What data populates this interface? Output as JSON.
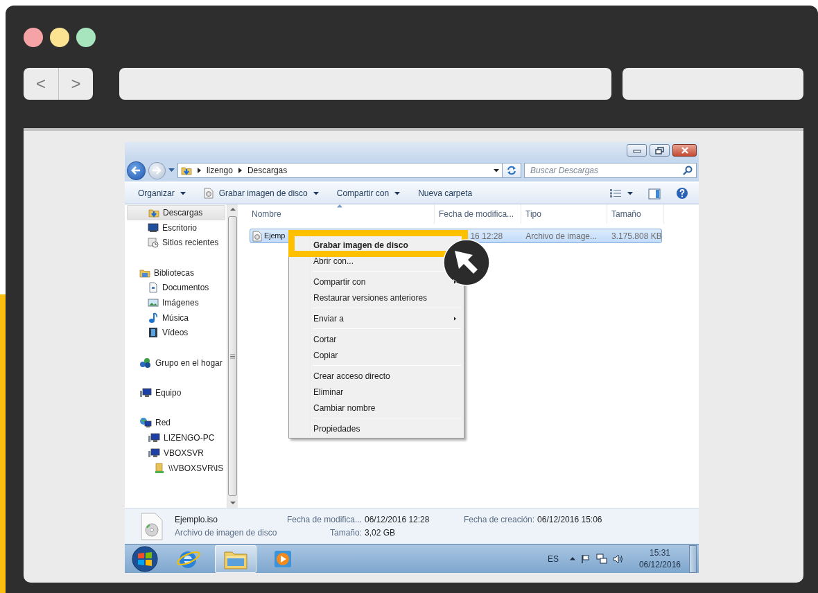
{
  "browser": {
    "lights": [
      {
        "color": "#f5a3a6"
      },
      {
        "color": "#fce391"
      },
      {
        "color": "#a6e5bd"
      }
    ],
    "back": "<",
    "forward": ">"
  },
  "explorer": {
    "breadcrumb": [
      "lizengo",
      "Descargas"
    ],
    "search": {
      "placeholder": "Buscar Descargas"
    },
    "toolbar": [
      {
        "label": "Organizar",
        "kind": "dropdown"
      },
      {
        "label": "Grabar imagen de disco",
        "kind": "burn"
      },
      {
        "label": "Compartir con",
        "kind": "dropdown"
      },
      {
        "label": "Nueva carpeta",
        "kind": "button"
      }
    ],
    "nav_pane": {
      "favorites": [
        {
          "label": "Descargas",
          "kind": "downloads",
          "selected": true
        },
        {
          "label": "Escritorio",
          "kind": "desktop",
          "selected": false
        },
        {
          "label": "Sitios recientes",
          "kind": "recent",
          "selected": false
        }
      ],
      "tree": [
        {
          "label": "Bibliotecas",
          "kind": "libraries",
          "selected": false,
          "children": [
            {
              "label": "Documentos",
              "kind": "documents",
              "selected": false
            },
            {
              "label": "Imágenes",
              "kind": "pictures",
              "selected": false
            },
            {
              "label": "Música",
              "kind": "music",
              "selected": false
            },
            {
              "label": "Vídeos",
              "kind": "videos",
              "selected": false
            }
          ]
        },
        {
          "label": "Grupo en el hogar",
          "kind": "homegroup",
          "selected": false
        },
        {
          "label": "Equipo",
          "kind": "computer",
          "selected": false
        },
        {
          "label": "Red",
          "kind": "network",
          "selected": false,
          "children": [
            {
              "label": "LIZENGO-PC",
              "kind": "computer",
              "selected": false
            },
            {
              "label": "VBOXSVR",
              "kind": "computer",
              "selected": false,
              "children": [
                {
                  "label": "\\\\VBOXSVR\\IS",
                  "kind": "share",
                  "selected": false
                }
              ]
            }
          ]
        }
      ]
    },
    "columns": [
      "Nombre",
      "Fecha de modifica...",
      "Tipo",
      "Tamaño"
    ],
    "rows": [
      {
        "cells": [
          "Ejemp",
          "16 12:28",
          "Archivo de image...",
          "3.175.808 KB"
        ],
        "selected": true
      }
    ],
    "context_menu": {
      "groups": [
        [
          {
            "label": "Grabar imagen de disco",
            "default": true,
            "submenu": false
          },
          {
            "label": "Abrir con...",
            "default": false,
            "submenu": false
          }
        ],
        [
          {
            "label": "Compartir con",
            "default": false,
            "submenu": true
          },
          {
            "label": "Restaurar versiones anteriores",
            "default": false,
            "submenu": false
          }
        ],
        [
          {
            "label": "Enviar a",
            "default": false,
            "submenu": true
          }
        ],
        [
          {
            "label": "Cortar",
            "default": false,
            "submenu": false
          },
          {
            "label": "Copiar",
            "default": false,
            "submenu": false
          }
        ],
        [
          {
            "label": "Crear acceso directo",
            "default": false,
            "submenu": false
          },
          {
            "label": "Eliminar",
            "default": false,
            "submenu": false
          },
          {
            "label": "Cambiar nombre",
            "default": false,
            "submenu": false
          }
        ],
        [
          {
            "label": "Propiedades",
            "default": false,
            "submenu": false
          }
        ]
      ]
    },
    "details": {
      "name": "Ejemplo.iso",
      "type": "Archivo de imagen de disco",
      "fields": [
        {
          "label": "Fecha de modifica...",
          "value": "06/12/2016 12:28"
        },
        {
          "label": "Tamaño:",
          "value": "3,02 GB"
        },
        {
          "label": "Fecha de creación:",
          "value": "06/12/2016 15:06"
        }
      ]
    }
  },
  "taskbar": {
    "buttons": [
      {
        "kind": "start",
        "selected": false
      },
      {
        "kind": "browser",
        "selected": false
      },
      {
        "kind": "explorer",
        "selected": true
      },
      {
        "kind": "media",
        "selected": false
      }
    ],
    "language": "ES",
    "time": "15:31",
    "date": "06/12/2016"
  }
}
